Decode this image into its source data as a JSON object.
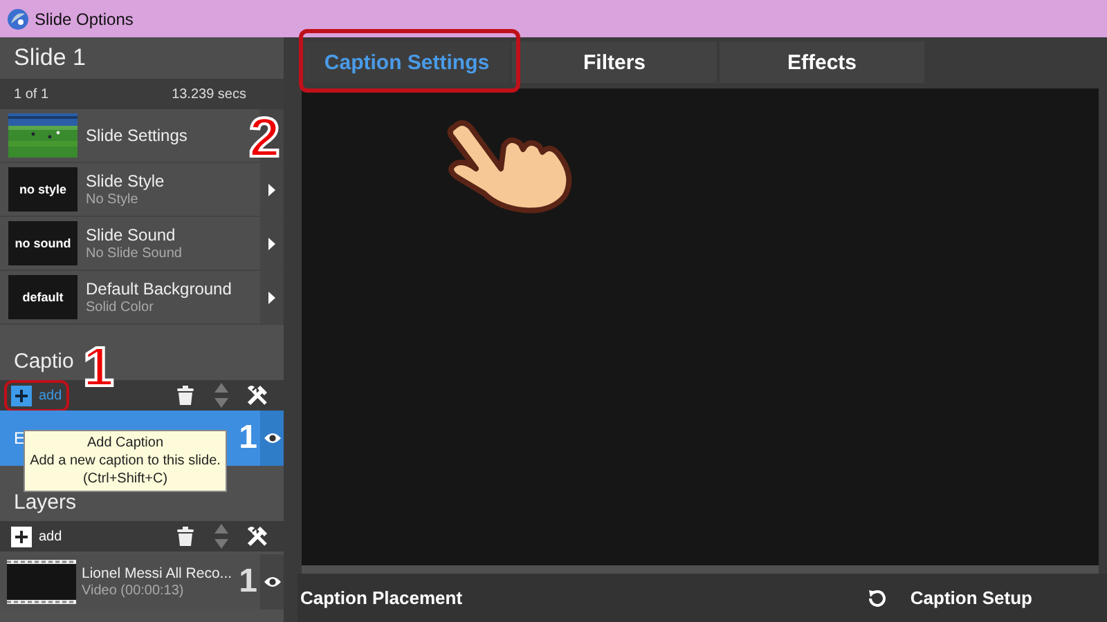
{
  "window": {
    "title": "Slide Options"
  },
  "slide": {
    "title": "Slide 1",
    "position": "1 of 1",
    "duration": "13.239 secs"
  },
  "options": [
    {
      "kind": "picture",
      "title": "Slide Settings"
    },
    {
      "kind": "label",
      "thumb": "no style",
      "title": "Slide Style",
      "subtitle": "No Style"
    },
    {
      "kind": "label",
      "thumb": "no sound",
      "title": "Slide Sound",
      "subtitle": "No Slide Sound"
    },
    {
      "kind": "label",
      "thumb": "default",
      "title": "Default Background",
      "subtitle": "Solid Color"
    }
  ],
  "captions": {
    "title": "Captio",
    "add": "add",
    "add_highlighted": true,
    "items": [
      {
        "text": "E",
        "number": "1",
        "selected": true
      }
    ],
    "tooltip": {
      "title": "Add Caption",
      "text": "Add a new caption to this slide.",
      "shortcut": "(Ctrl+Shift+C)"
    }
  },
  "layers": {
    "title": "Layers",
    "add": "add",
    "add_highlighted": false,
    "items": [
      {
        "title": "Lionel Messi All Reco...",
        "subtitle": "Video (00:00:13)",
        "number": "1",
        "selected": false
      }
    ]
  },
  "tabs": [
    {
      "label": "Caption Settings",
      "selected": true
    },
    {
      "label": "Filters",
      "selected": false
    },
    {
      "label": "Effects",
      "selected": false
    }
  ],
  "footer": {
    "left": "Caption Placement",
    "right": "Caption Setup"
  },
  "annotations": [
    {
      "label": "1"
    },
    {
      "label": "2"
    }
  ]
}
